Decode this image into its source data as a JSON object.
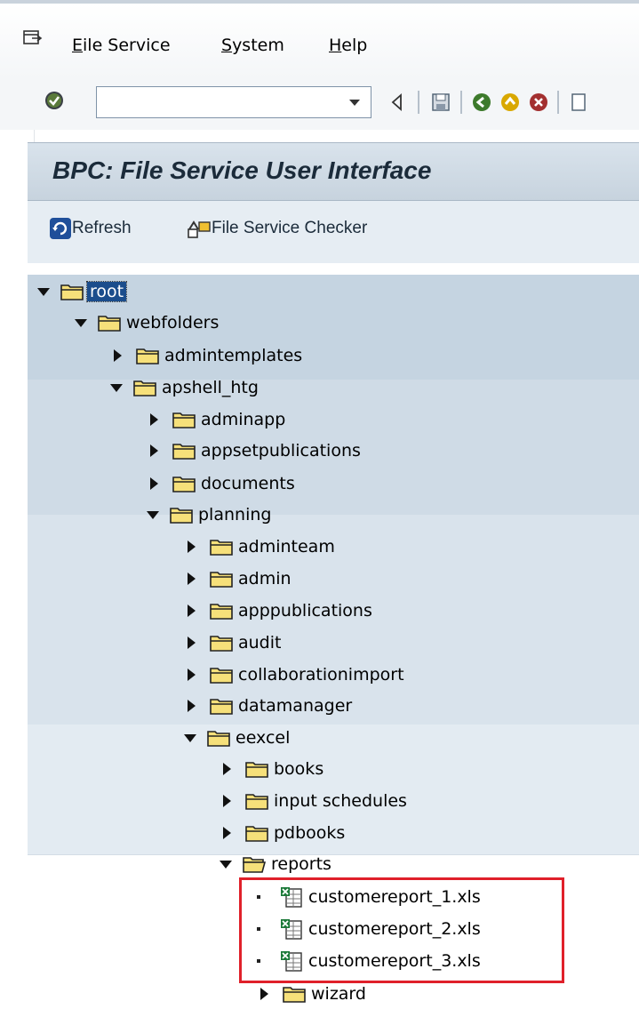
{
  "menu": {
    "items": [
      {
        "key": "E",
        "rest": "ile Service",
        "label": "File Service"
      },
      {
        "key": "S",
        "rest": "ystem",
        "label": "System"
      },
      {
        "key": "H",
        "rest": "elp",
        "label": "Help"
      }
    ]
  },
  "toolbar": {
    "command_value": "",
    "icons": [
      "enter-check-icon",
      "dropdown-icon",
      "back-triangle-icon",
      "save-icon",
      "back-icon",
      "exit-icon",
      "cancel-icon",
      "print-icon"
    ]
  },
  "page": {
    "title": "BPC: File Service User Interface"
  },
  "app_toolbar": {
    "refresh_label": "Refresh",
    "checker_label": "File Service Checker"
  },
  "tree": {
    "root": "root",
    "webfolders": "webfolders",
    "admintemplates": "admintemplates",
    "apshell_htg": "apshell_htg",
    "adminapp": "adminapp",
    "appsetpublications": "appsetpublications",
    "documents": "documents",
    "planning": "planning",
    "adminteam": "adminteam",
    "admin": "admin",
    "apppublications": "apppublications",
    "audit": "audit",
    "collaborationimport": "collaborationimport",
    "datamanager": "datamanager",
    "eexcel": "eexcel",
    "books": "books",
    "input_schedules": "input schedules",
    "pdbooks": "pdbooks",
    "reports": "reports",
    "file1": "customereport_1.xls",
    "file2": "customereport_2.xls",
    "file3": "customereport_3.xls",
    "wizard": "wizard"
  },
  "colors": {
    "highlight_box": "#e0202a",
    "selection": "#1b4d8c"
  }
}
